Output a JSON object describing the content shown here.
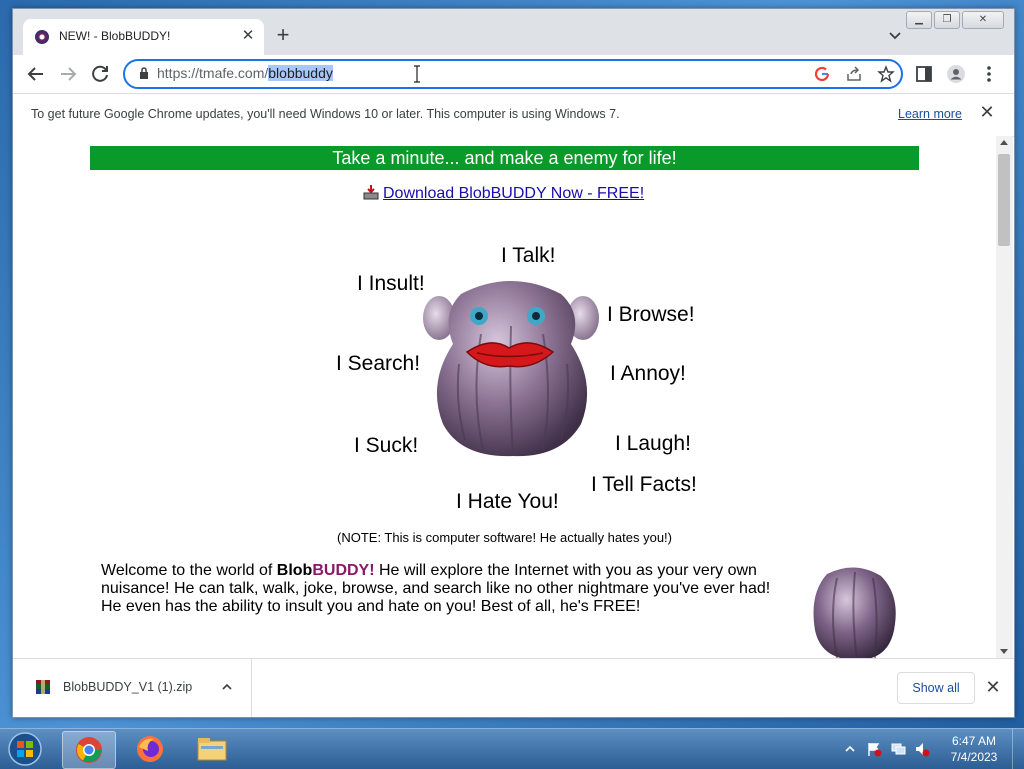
{
  "browser": {
    "tab_title": "NEW! - BlobBUDDY!",
    "tab_close": "✕",
    "new_tab": "+",
    "url_prefix": "https://tmafe.com/",
    "url_selected": "blobbuddy"
  },
  "infobar": {
    "message": "To get future Google Chrome updates, you'll need Windows 10 or later. This computer is using Windows 7.",
    "link": "Learn more",
    "close": "✕"
  },
  "page": {
    "banner": "Take a minute... and make a enemy for life!",
    "download_link": "Download BlobBUDDY Now - FREE!",
    "callouts": {
      "talk": "I Talk!",
      "insult": "I Insult!",
      "browse": "I Browse!",
      "search": "I Search!",
      "annoy": "I Annoy!",
      "suck": "I Suck!",
      "laugh": "I Laugh!",
      "tell_facts": "I Tell Facts!",
      "hate_you": "I Hate You!"
    },
    "note": "(NOTE: This is computer software! He actually hates you!)",
    "welcome": {
      "prefix": "Welcome to the world of ",
      "brand_a": "Blob",
      "brand_b": "BUDDY!",
      "body": " He will explore the Internet with you as your very own nuisance!  He can talk, walk, joke, browse, and search like no other nightmare you've ever had!  He even has the ability to insult you and hate on you! Best of all, he's FREE!"
    }
  },
  "download_shelf": {
    "filename": "BlobBUDDY_V1 (1).zip",
    "show_all": "Show all",
    "close": "✕"
  },
  "taskbar": {
    "time": "6:47 AM",
    "date": "7/4/2023",
    "apps": [
      "chrome-icon",
      "firefox-icon",
      "file-explorer-icon"
    ]
  },
  "colors": {
    "banner_bg": "#0a9a2a",
    "brand_purple": "#8b1a66",
    "link_blue": "#1a0dab",
    "focus_blue": "#1a73e8"
  }
}
